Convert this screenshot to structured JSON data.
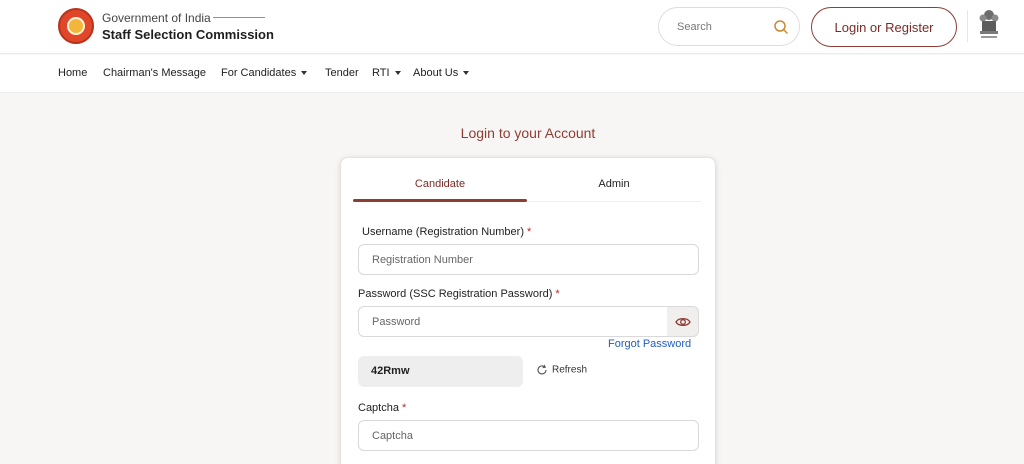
{
  "header": {
    "gov_title": "Government of India",
    "org_title": "Staff Selection Commission",
    "search_placeholder": "Search",
    "login_label": "Login or Register"
  },
  "nav": {
    "items": [
      {
        "label": "Home"
      },
      {
        "label": "Chairman's Message"
      },
      {
        "label": "For Candidates"
      },
      {
        "label": "Tender"
      },
      {
        "label": "RTI"
      },
      {
        "label": "About Us"
      }
    ]
  },
  "main": {
    "heading": "Login to your Account",
    "tabs": [
      {
        "label": "Candidate"
      },
      {
        "label": "Admin"
      }
    ],
    "username_label": "Username (Registration Number)",
    "username_placeholder": "Registration Number",
    "password_label": "Password (SSC Registration Password)",
    "password_placeholder": "Password",
    "forgot_label": "Forgot Password",
    "captcha_code": "42Rmw",
    "refresh_label": "Refresh",
    "captcha_label": "Captcha",
    "captcha_placeholder": "Captcha",
    "required_marker": "*"
  },
  "colors": {
    "accent": "#8e3d35",
    "link": "#1f5fbf",
    "required": "#c02525"
  }
}
